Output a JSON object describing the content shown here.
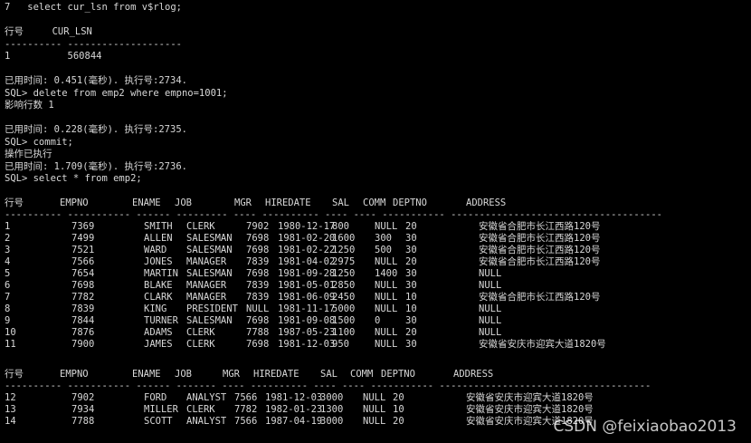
{
  "terminal": {
    "lines": [
      "7   select cur_lsn from v$rlog;",
      "",
      "行号     CUR_LSN",
      "---------- --------------------",
      "1          560844",
      "",
      "已用时间: 0.451(毫秒). 执行号:2734.",
      "SQL> delete from emp2 where empno=1001;",
      "影响行数 1",
      "",
      "已用时间: 0.228(毫秒). 执行号:2735.",
      "SQL> commit;",
      "操作已执行",
      "已用时间: 1.709(毫秒). 执行号:2736.",
      "SQL> select * from emp2;"
    ]
  },
  "result_table_1": {
    "headers": [
      "行号",
      "EMPNO",
      "ENAME",
      "JOB",
      "MGR",
      "HIREDATE",
      "SAL",
      "COMM",
      "DEPTNO",
      "ADDRESS"
    ],
    "separator": "---------- ----------- ------ --------- ---- ---------- ---- ---- ----------- -------------------------------------",
    "rows": [
      [
        "1",
        "7369",
        "SMITH",
        "CLERK",
        "7902",
        "1980-12-17",
        "800",
        "NULL",
        "20",
        "安徽省合肥市长江西路120号"
      ],
      [
        "2",
        "7499",
        "ALLEN",
        "SALESMAN",
        "7698",
        "1981-02-20",
        "1600",
        "300",
        "30",
        "安徽省合肥市长江西路120号"
      ],
      [
        "3",
        "7521",
        "WARD",
        "SALESMAN",
        "7698",
        "1981-02-22",
        "1250",
        "500",
        "30",
        "安徽省合肥市长江西路120号"
      ],
      [
        "4",
        "7566",
        "JONES",
        "MANAGER",
        "7839",
        "1981-04-02",
        "2975",
        "NULL",
        "20",
        "安徽省合肥市长江西路120号"
      ],
      [
        "5",
        "7654",
        "MARTIN",
        "SALESMAN",
        "7698",
        "1981-09-28",
        "1250",
        "1400",
        "30",
        "NULL"
      ],
      [
        "6",
        "7698",
        "BLAKE",
        "MANAGER",
        "7839",
        "1981-05-01",
        "2850",
        "NULL",
        "30",
        "NULL"
      ],
      [
        "7",
        "7782",
        "CLARK",
        "MANAGER",
        "7839",
        "1981-06-09",
        "2450",
        "NULL",
        "10",
        "安徽省合肥市长江西路120号"
      ],
      [
        "8",
        "7839",
        "KING",
        "PRESIDENT",
        "NULL",
        "1981-11-17",
        "5000",
        "NULL",
        "10",
        "NULL"
      ],
      [
        "9",
        "7844",
        "TURNER",
        "SALESMAN",
        "7698",
        "1981-09-08",
        "1500",
        "0",
        "30",
        "NULL"
      ],
      [
        "10",
        "7876",
        "ADAMS",
        "CLERK",
        "7788",
        "1987-05-23",
        "1100",
        "NULL",
        "20",
        "NULL"
      ],
      [
        "11",
        "7900",
        "JAMES",
        "CLERK",
        "7698",
        "1981-12-03",
        "950",
        "NULL",
        "30",
        "安徽省安庆市迎宾大道1820号"
      ]
    ]
  },
  "result_table_2": {
    "headers": [
      "行号",
      "EMPNO",
      "ENAME",
      "JOB",
      "MGR",
      "HIREDATE",
      "SAL",
      "COMM",
      "DEPTNO",
      "ADDRESS"
    ],
    "separator": "---------- ----------- ------ ------- ---- ---------- ---- ---- ----------- -------------------------------------",
    "rows": [
      [
        "12",
        "7902",
        "FORD",
        "ANALYST",
        "7566",
        "1981-12-03",
        "3000",
        "NULL",
        "20",
        "安徽省安庆市迎宾大道1820号"
      ],
      [
        "13",
        "7934",
        "MILLER",
        "CLERK",
        "7782",
        "1982-01-23",
        "1300",
        "NULL",
        "10",
        "安徽省安庆市迎宾大道1820号"
      ],
      [
        "14",
        "7788",
        "SCOTT",
        "ANALYST",
        "7566",
        "1987-04-19",
        "3000",
        "NULL",
        "20",
        "安徽省安庆市迎宾大道1820号"
      ]
    ]
  },
  "watermark": "CSDN @feixiaobao2013"
}
